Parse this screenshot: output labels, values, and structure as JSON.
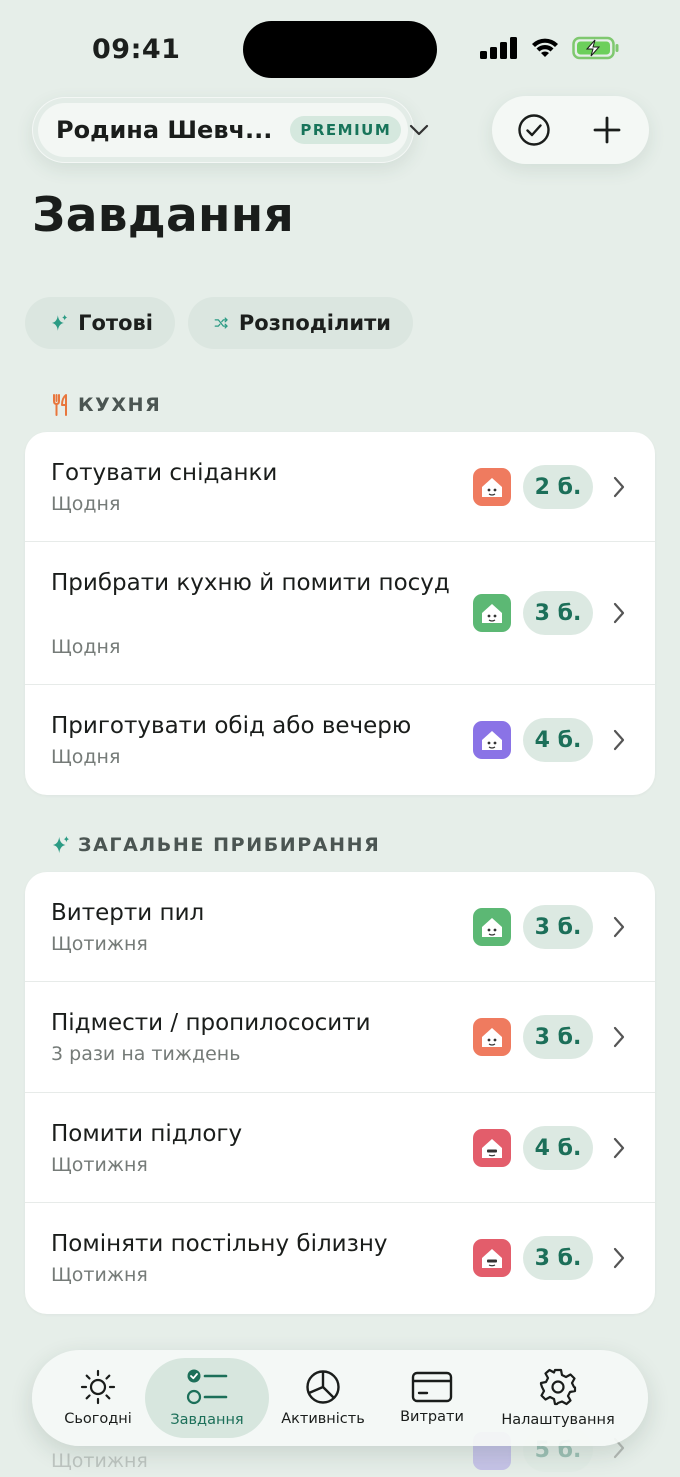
{
  "status_bar": {
    "time": "09:41"
  },
  "header": {
    "family_name": "Родина Шевч...",
    "premium_badge": "PREMIUM"
  },
  "page_title": "Завдання",
  "chips": [
    {
      "label": "Готові"
    },
    {
      "label": "Розподілити"
    }
  ],
  "sections": [
    {
      "title": "КУХНЯ",
      "tasks": [
        {
          "title": "Готувати сніданки",
          "frequency": "Щодня",
          "points": "2 б.",
          "avatar_color": "#ef7b5f"
        },
        {
          "title": "Прибрати кухню й помити посуд",
          "frequency": "Щодня",
          "points": "3 б.",
          "avatar_color": "#5cb874"
        },
        {
          "title": "Приготувати обід або вечерю",
          "frequency": "Щодня",
          "points": "4 б.",
          "avatar_color": "#8a73e6"
        }
      ]
    },
    {
      "title": "ЗАГАЛЬНЕ ПРИБИРАННЯ",
      "tasks": [
        {
          "title": "Витерти пил",
          "frequency": "Щотижня",
          "points": "3 б.",
          "avatar_color": "#5cb874"
        },
        {
          "title": "Підмести / пропилососити",
          "frequency": "3 рази на тиждень",
          "points": "3 б.",
          "avatar_color": "#ef7b5f"
        },
        {
          "title": "Помити підлогу",
          "frequency": "Щотижня",
          "points": "4 б.",
          "avatar_color": "#e35d6b"
        },
        {
          "title": "Поміняти постільну білизну",
          "frequency": "Щотижня",
          "points": "3 б.",
          "avatar_color": "#e35d6b"
        }
      ]
    }
  ],
  "partial_bottom": {
    "frequency": "Щотижня",
    "points": "5 б."
  },
  "tabbar": {
    "items": [
      {
        "label": "Сьогодні",
        "icon": "sun-icon"
      },
      {
        "label": "Завдання",
        "icon": "task-list-icon",
        "active": true
      },
      {
        "label": "Активність",
        "icon": "pie-chart-icon"
      },
      {
        "label": "Витрати",
        "icon": "card-icon"
      },
      {
        "label": "Налаштування",
        "icon": "gear-icon"
      }
    ]
  },
  "colors": {
    "accent": "#1c6f59",
    "background": "#e6eee9",
    "kitchen_icon": "#e8763d",
    "sparkle_icon": "#2b9b84"
  }
}
